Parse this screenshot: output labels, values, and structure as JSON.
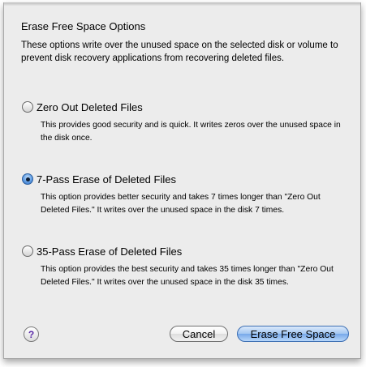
{
  "dialog": {
    "title": "Erase Free Space Options",
    "intro": "These options write over the unused space on the selected disk or volume to prevent disk recovery applications from recovering deleted files."
  },
  "options": [
    {
      "label": "Zero Out Deleted Files",
      "description": "This provides good security and is quick. It writes zeros over the unused space in the disk once.",
      "selected": false
    },
    {
      "label": "7-Pass Erase of Deleted Files",
      "description": "This option provides better security and takes 7 times longer than \"Zero Out Deleted Files.\" It writes over the unused space in the disk 7 times.",
      "selected": true
    },
    {
      "label": "35-Pass Erase of Deleted Files",
      "description": "This option provides the best security and takes 35 times longer than \"Zero Out Deleted Files.\" It writes over the unused space in the disk 35 times.",
      "selected": false
    }
  ],
  "buttons": {
    "help": "?",
    "cancel": "Cancel",
    "primary": "Erase Free Space"
  },
  "colors": {
    "window_bg": "#ececec",
    "primary_button": "#77a8e9",
    "radio_selected": "#2d6fc8"
  },
  "icons": {
    "help": "help-icon",
    "radio_on": "radio-selected",
    "radio_off": "radio-unselected"
  }
}
